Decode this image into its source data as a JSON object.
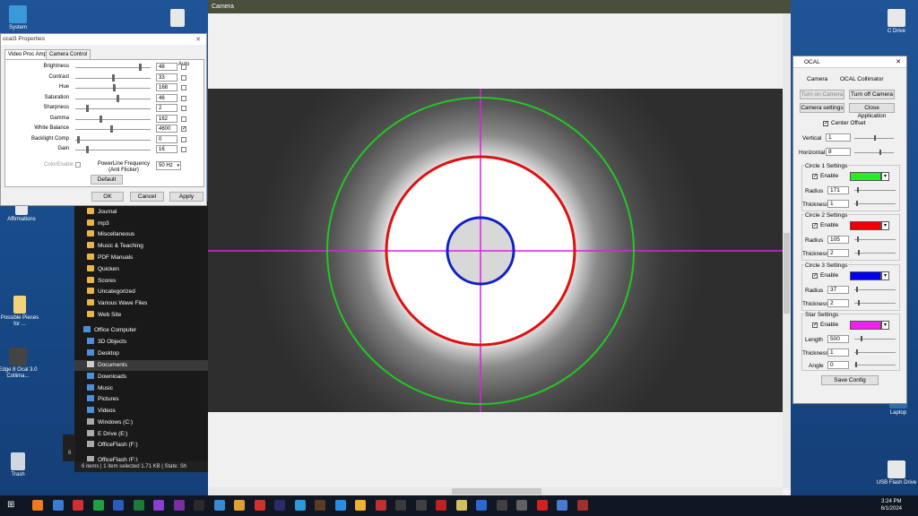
{
  "desktop": {
    "icons_left": [
      {
        "label": "System",
        "color": "#3a9ad9"
      },
      {
        "label": "",
        "color": "#e8e8e8"
      },
      {
        "label": "Affirmations",
        "color": "#e8e8e8"
      },
      {
        "label": "Possible Pieces for ...",
        "color": "#f3d37a"
      },
      {
        "label": "Edge 8 Ocal 3.0 Collima...",
        "color": "#444444"
      },
      {
        "label": "Trash",
        "color": "#cfd8e0"
      }
    ],
    "icons_right": [
      {
        "label": "C Drive",
        "color": "#e8e8e8"
      },
      {
        "label": "Laptop",
        "color": "#2a6fb0"
      },
      {
        "label": "USB Flash Drive",
        "color": "#e8e8e8"
      }
    ]
  },
  "properties_dialog": {
    "title": "ocal3 Properties",
    "tabs": [
      "Video Proc Amp",
      "Camera Control"
    ],
    "auto_header": "Auto",
    "rows": [
      {
        "label": "Brightness",
        "value": "48",
        "level": 0.88,
        "auto": false
      },
      {
        "label": "Contrast",
        "value": "33",
        "level": 0.5,
        "auto": false
      },
      {
        "label": "Hue",
        "value": "168",
        "level": 0.52,
        "auto": false
      },
      {
        "label": "Saturation",
        "value": "46",
        "level": 0.57,
        "auto": false
      },
      {
        "label": "Sharpness",
        "value": "2",
        "level": 0.15,
        "auto": false
      },
      {
        "label": "Gamma",
        "value": "162",
        "level": 0.33,
        "auto": false
      },
      {
        "label": "White Balance",
        "value": "4600",
        "level": 0.48,
        "auto": true
      },
      {
        "label": "Backlight Comp",
        "value": "0",
        "level": 0.02,
        "auto": false
      },
      {
        "label": "Gain",
        "value": "16",
        "level": 0.15,
        "auto": false
      }
    ],
    "color_enable_label": "ColorEnable",
    "powerline_label": "PowerLine Frequency (Anti Flicker)",
    "powerline_value": "50 Hz",
    "default_label": "Default",
    "ok_label": "OK",
    "cancel_label": "Cancel",
    "apply_label": "Apply",
    "close_glyph": "✕"
  },
  "explorer": {
    "folders": [
      "Journal",
      "mp3",
      "Miscellaneous",
      "Music & Teaching",
      "PDF Manuals",
      "Quicken",
      "Scores",
      "Uncategorized",
      "Various Wave Files",
      "Web Site"
    ],
    "places": [
      "Office Computer",
      "3D Objects",
      "Desktop",
      "Documents",
      "Downloads",
      "Music",
      "Pictures",
      "Videos",
      "Windows (C:)",
      "E Drive (E:)",
      "OfficeFlash (F:)",
      "OfficeFlash (F:)"
    ],
    "selected_place": "Documents",
    "status": "6 items  |  1 item selected  1.71 KB  |  State: Sh",
    "side_numbers": [
      "6"
    ]
  },
  "camera_window": {
    "title": "Camera",
    "colors": {
      "circle1": "#22c822",
      "circle2": "#e01010",
      "circle3": "#1020c8",
      "star": "#e020e0"
    }
  },
  "ocal_panel": {
    "title": "OCAL",
    "close_glyph": "✕",
    "camera_label": "Camera",
    "collimator_label": "OCAL Collimator",
    "turn_on_label": "Turn on Camera",
    "turn_off_label": "Turn off Camera",
    "camera_settings_label": "Camera settings",
    "close_app_label": "Close Application",
    "center_offset_label": "Center Offset",
    "vertical_label": "Vertical",
    "vertical_value": "1",
    "horizontal_label": "Horizontal",
    "horizontal_value": "8",
    "circle1": {
      "title": "Circle 1 Settings",
      "enable": "Enable",
      "radius_label": "Radius",
      "radius": "171",
      "thickness_label": "Thickness",
      "thickness": "1",
      "color": "#22ee22"
    },
    "circle2": {
      "title": "Circle 2 Settings",
      "enable": "Enable",
      "radius_label": "Radius",
      "radius": "105",
      "thickness_label": "Thickness",
      "thickness": "2",
      "color": "#ee0000"
    },
    "circle3": {
      "title": "Circle 3 Settings",
      "enable": "Enable",
      "radius_label": "Radius",
      "radius": "37",
      "thickness_label": "Thickness",
      "thickness": "2",
      "color": "#0000ee"
    },
    "star": {
      "title": "Star Settings",
      "enable": "Enable",
      "length_label": "Length",
      "length": "500",
      "thickness_label": "Thickness",
      "thickness": "1",
      "angle_label": "Angle",
      "angle": "0",
      "color": "#ee22ee"
    },
    "save_label": "Save Config"
  },
  "taskbar": {
    "time": "3:24 PM",
    "date": "6/1/2024",
    "icon_colors": [
      "#f07a20",
      "#3a7bd5",
      "#d03030",
      "#20a040",
      "#2a5cbf",
      "#1e7a3a",
      "#8a3fcf",
      "#7a2fa0",
      "#2a2a2a",
      "#3a8ad0",
      "#e0a030",
      "#d03030",
      "#2b2b6a",
      "#2a9ad8",
      "#5a3a20",
      "#2a8ce0",
      "#f0b030",
      "#c03030",
      "#3a3a3a",
      "#404040",
      "#c02020",
      "#d0c060",
      "#2a6ad0",
      "#404040",
      "#606060",
      "#d02020",
      "#4a7ad0",
      "#a03030"
    ]
  }
}
